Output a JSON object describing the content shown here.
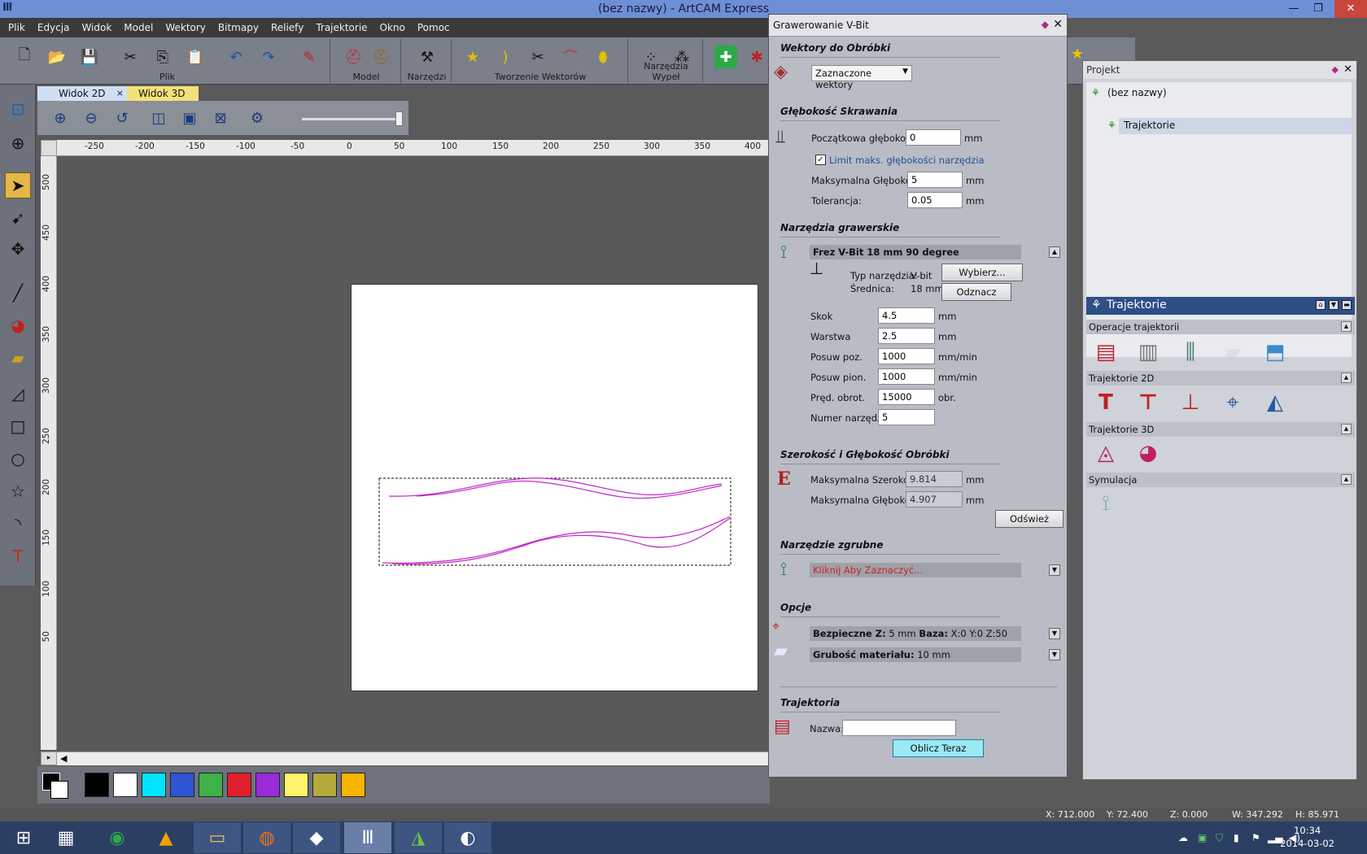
{
  "window": {
    "title": "(bez nazwy) - ArtCAM Express",
    "app_icon": "artcam-icon"
  },
  "menu": [
    "Plik",
    "Edycja",
    "Widok",
    "Model",
    "Wektory",
    "Bitmapy",
    "Reliefy",
    "Trajektorie",
    "Okno",
    "Pomoc"
  ],
  "toolbar_groups": [
    "Plik",
    "Model",
    "Narzędzi",
    "Tworzenie Wektorów",
    "Narzędzia Wypeł"
  ],
  "tabs": {
    "view2d": "Widok 2D",
    "view3d": "Widok 3D",
    "close": "×"
  },
  "ruler": {
    "top": [
      "-250",
      "-200",
      "-150",
      "-100",
      "-50",
      "0",
      "50",
      "100",
      "150",
      "200",
      "250",
      "300",
      "350",
      "400"
    ],
    "left": [
      "500",
      "450",
      "400",
      "350",
      "300",
      "250",
      "200",
      "150",
      "100",
      "50"
    ]
  },
  "palette": {
    "colors": [
      "#000000",
      "#ffffff",
      "#00e5ff",
      "#2f55d4",
      "#3fb04a",
      "#e0202a",
      "#9b2ad8",
      "#fff36b",
      "#b3a93c",
      "#f7b500"
    ]
  },
  "vbit_panel": {
    "title": "Grawerowanie V-Bit",
    "sec_vectors": "Wektory do Obróbki",
    "vectors_select": "Zaznaczone wektory",
    "sec_depth": "Głębokość Skrawania",
    "start_depth_label": "Początkowa głębokość:",
    "start_depth": "0",
    "limit_label": "Limit maks. głębokości narzędzia",
    "limit_checked": true,
    "max_depth_label": "Maksymalna Głębokość:",
    "max_depth": "5",
    "tolerance_label": "Tolerancja:",
    "tolerance": "0.05",
    "unit_mm": "mm",
    "sec_tools": "Narzędzia grawerskie",
    "tool_name": "Frez V-Bit 18 mm 90 degree",
    "tool_type_label": "Typ narzędzia:",
    "tool_type": "V-bit",
    "diameter_label": "Średnica:",
    "diameter": "18 mm",
    "select_btn": "Wybierz...",
    "deselect_btn": "Odznacz",
    "params": [
      {
        "label": "Skok",
        "value": "4.5",
        "unit": "mm"
      },
      {
        "label": "Warstwa",
        "value": "2.5",
        "unit": "mm"
      },
      {
        "label": "Posuw poz.",
        "value": "1000",
        "unit": "mm/min"
      },
      {
        "label": "Posuw pion.",
        "value": "1000",
        "unit": "mm/min"
      },
      {
        "label": "Pręd. obrot.",
        "value": "15000",
        "unit": "obr."
      },
      {
        "label": "Numer narzędzia",
        "value": "5",
        "unit": ""
      }
    ],
    "sec_width": "Szerokość i Głębokość Obróbki",
    "max_width_label": "Maksymalna Szerokość:",
    "max_width": "9.814",
    "max_depth2_label": "Maksymalna Głębokość:",
    "max_depth2": "4.907",
    "refresh_btn": "Odśwież",
    "sec_rough": "Narzędzie zgrubne",
    "rough_prompt": "Kliknij Aby Zaznaczyć...",
    "sec_options": "Opcje",
    "safe_z_label": "Bezpieczne Z:",
    "safe_z_value": "5 mm",
    "base_label": "Baza:",
    "base_value": "X:0 Y:0 Z:50",
    "material_label": "Grubość materiału:",
    "material_value": "10 mm",
    "sec_toolpath": "Trajektoria",
    "name_label": "Nazwa:",
    "name_value": "",
    "compute_btn": "Oblicz Teraz"
  },
  "project_panel": {
    "title": "Projekt",
    "root": "(bez nazwy)",
    "child": "Trajektorie",
    "traj_header": "Trajektorie",
    "sections": [
      "Operacje trajektorii",
      "Trajektorie 2D",
      "Trajektorie 3D",
      "Symulacja"
    ]
  },
  "status": {
    "x": "X: 712.000",
    "y": "Y: 72.400",
    "z": "Z: 0.000",
    "w": "W: 347.292",
    "h": "H: 85.971"
  },
  "clock": {
    "time": "10:34",
    "date": "2014-03-02"
  }
}
